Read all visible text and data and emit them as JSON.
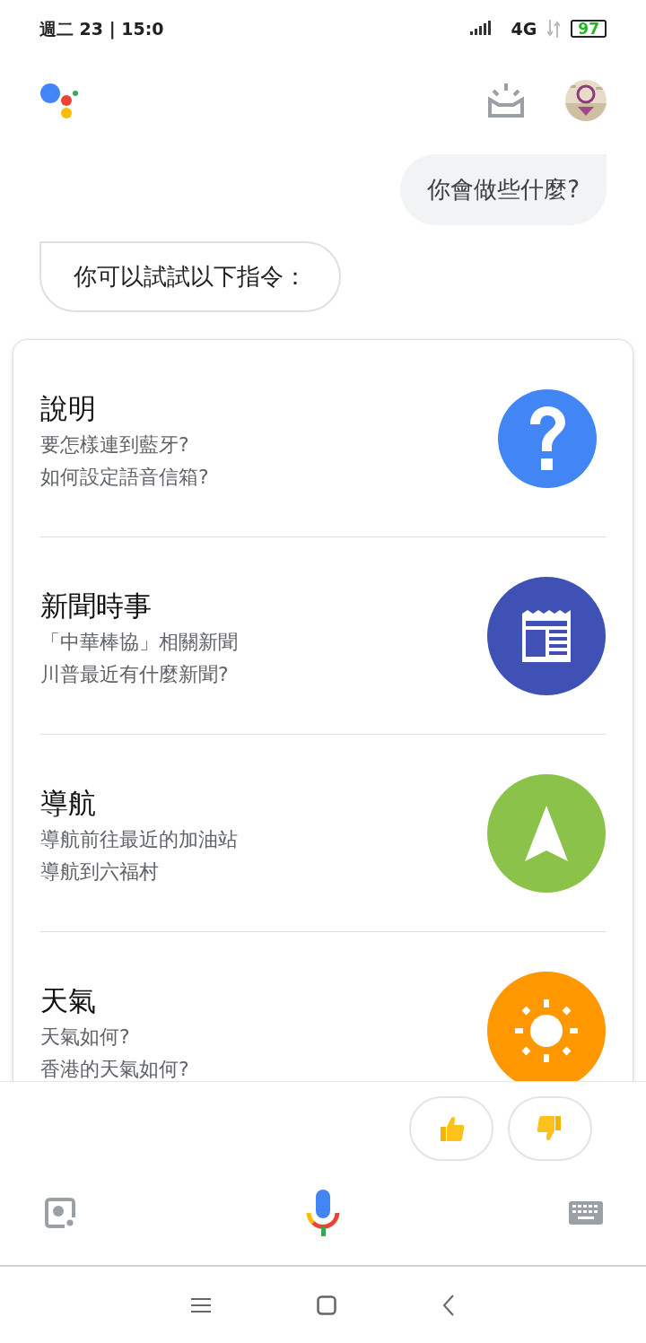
{
  "status_bar": {
    "time": "週二 23 | 15:0",
    "network": "4G",
    "battery": "97"
  },
  "conversation": [
    {
      "kind": "user",
      "text": "你會做些什麼?"
    },
    {
      "kind": "assistant",
      "text": "你可以試試以下指令："
    }
  ],
  "suggestions": [
    {
      "kind": "help",
      "title": "說明",
      "examples": [
        "要怎樣連到藍牙?",
        "如何設定語音信箱?"
      ]
    },
    {
      "kind": "news",
      "title": "新聞時事",
      "examples": [
        "「中華棒協」相關新聞",
        "川普最近有什麼新聞?"
      ]
    },
    {
      "kind": "navigation",
      "title": "導航",
      "examples": [
        "導航前往最近的加油站",
        "導航到六福村"
      ]
    },
    {
      "kind": "weather",
      "title": "天氣",
      "examples": [
        "天氣如何?",
        "香港的天氣如何?"
      ]
    }
  ]
}
